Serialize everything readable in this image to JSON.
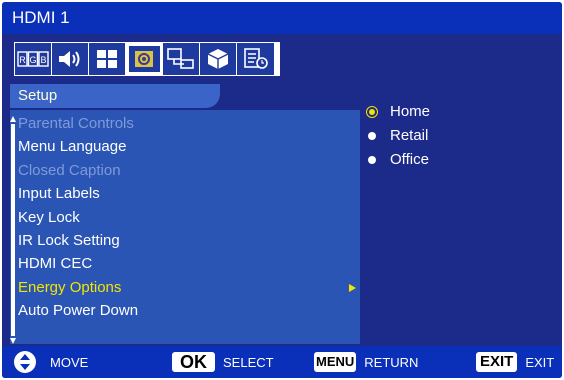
{
  "window": {
    "title": "HDMI 1"
  },
  "icon_bar": {
    "items": [
      {
        "name": "rgb-picture-icon",
        "label": "RGB"
      },
      {
        "name": "speaker-audio-icon"
      },
      {
        "name": "grid-schedule-icon"
      },
      {
        "name": "gear-setup-icon",
        "active": true
      },
      {
        "name": "network-computer-icon"
      },
      {
        "name": "cube-advanced-icon"
      },
      {
        "name": "info-clock-icon"
      }
    ]
  },
  "section": {
    "label": "Setup"
  },
  "menu": {
    "items": [
      {
        "label": "Parental Controls",
        "state": "disabled"
      },
      {
        "label": "Menu Language",
        "state": "normal"
      },
      {
        "label": "Closed Caption",
        "state": "disabled"
      },
      {
        "label": "Input Labels",
        "state": "normal"
      },
      {
        "label": "Key Lock",
        "state": "normal"
      },
      {
        "label": "IR Lock Setting",
        "state": "normal"
      },
      {
        "label": "HDMI CEC",
        "state": "normal"
      },
      {
        "label": "Energy Options",
        "state": "selected"
      },
      {
        "label": "Auto Power Down",
        "state": "normal"
      }
    ]
  },
  "options": {
    "items": [
      {
        "label": "Home",
        "current": true
      },
      {
        "label": "Retail",
        "current": false
      },
      {
        "label": "Office",
        "current": false
      }
    ]
  },
  "footer": {
    "move_label": "MOVE",
    "ok_key": "OK",
    "select_label": "SELECT",
    "menu_key": "MENU",
    "return_label": "RETURN",
    "exit_key": "EXIT",
    "exit_label": "EXIT"
  },
  "colors": {
    "background": "#1c2a8a",
    "title_bar": "#0a2fb8",
    "menu_panel": "#2a55b4",
    "highlight_text": "#f4e400",
    "disabled_text": "#7f9ad8"
  }
}
